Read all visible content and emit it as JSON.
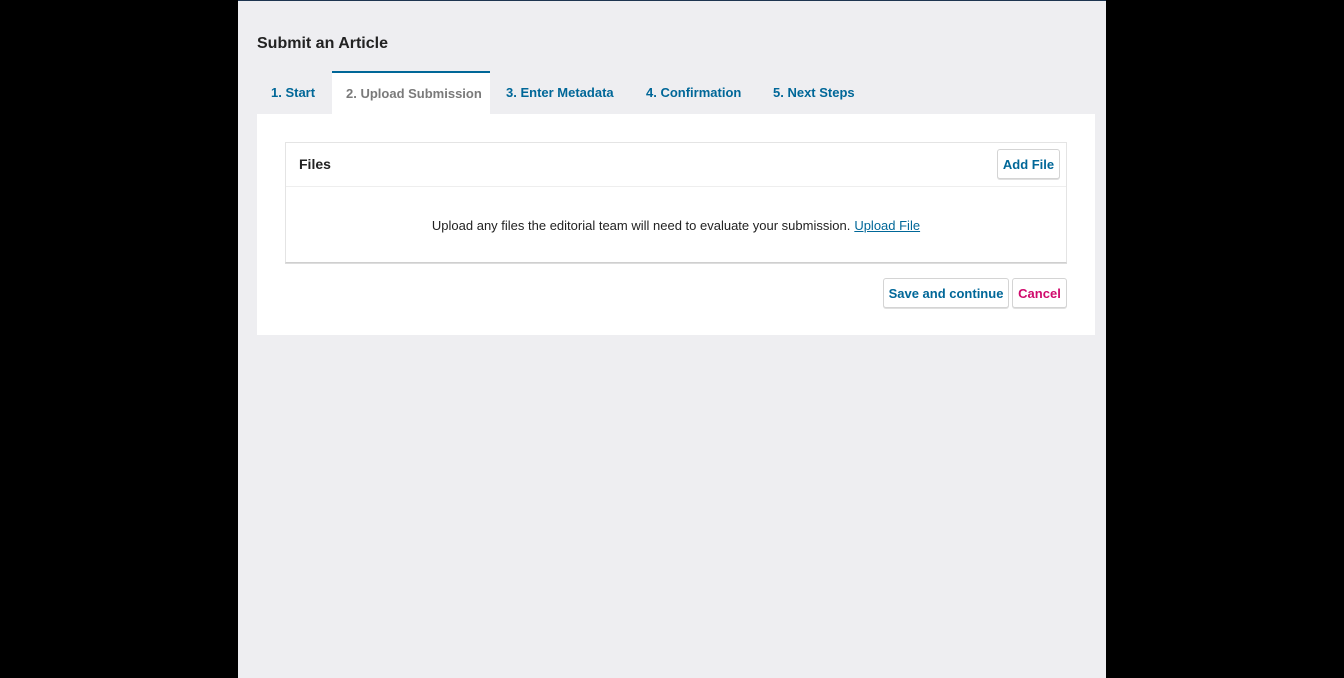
{
  "page": {
    "title": "Submit an Article"
  },
  "tabs": [
    {
      "label": "1. Start",
      "active": false
    },
    {
      "label": "2. Upload Submission",
      "active": true
    },
    {
      "label": "3. Enter Metadata",
      "active": false
    },
    {
      "label": "4. Confirmation",
      "active": false
    },
    {
      "label": "5. Next Steps",
      "active": false
    }
  ],
  "files": {
    "title": "Files",
    "add_button": "Add File",
    "empty_message": "Upload any files the editorial team will need to evaluate your submission.",
    "upload_link": "Upload File"
  },
  "actions": {
    "save_label": "Save and continue",
    "cancel_label": "Cancel"
  },
  "colors": {
    "link": "#006798",
    "cancel": "#d00a6c",
    "page_background": "#eeeef1",
    "outer_background": "#000000"
  }
}
